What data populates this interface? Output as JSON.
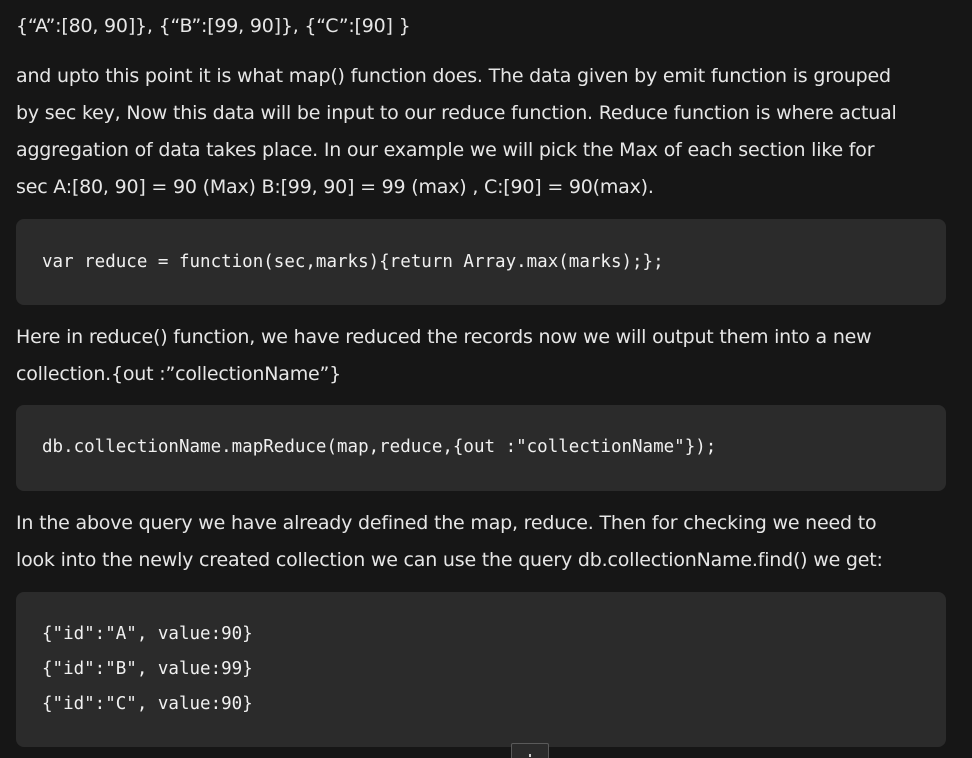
{
  "top_line": "{“A”:[80, 90]},  {“B”:[99, 90]},  {“C”:[90] }",
  "para1": {
    "lines": [
      "and upto this point it is what map() function does. The data given by emit function is grouped",
      "by sec key, Now this data will be input to our reduce function. Reduce function is where actual",
      "aggregation of data takes place. In our example we will pick the Max of each section like for",
      "sec A:[80, 90] = 90 (Max)  B:[99, 90] = 99 (max) , C:[90] = 90(max)."
    ]
  },
  "code1": {
    "lines": [
      "var reduce = function(sec,marks){return Array.max(marks);};"
    ]
  },
  "para2": {
    "lines": [
      "Here in reduce() function, we have reduced the records now we will output them into a new",
      "collection.{out :”collectionName”}"
    ]
  },
  "code2": {
    "lines": [
      "db.collectionName.mapReduce(map,reduce,{out :\"collectionName\"});"
    ]
  },
  "para3": {
    "lines": [
      "In the above query we have already defined the map, reduce. Then for checking we need to",
      "look into the newly created collection we can use the query db.collectionName.find() we get:"
    ]
  },
  "code3": {
    "lines": [
      "{\"id\":\"A\", value:90}",
      "{\"id\":\"B\", value:99}",
      "{\"id\":\"C\", value:90}"
    ]
  },
  "colors": {
    "background": "#161616",
    "code_block": "#2b2b2b",
    "text": "#e6e6e6"
  }
}
